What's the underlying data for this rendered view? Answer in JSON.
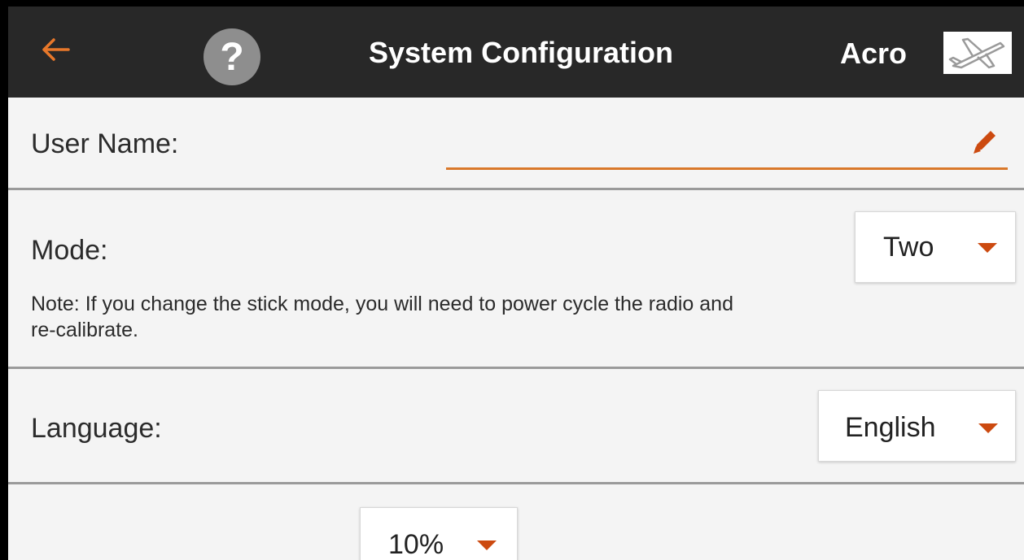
{
  "header": {
    "back_icon": "arrow-left-icon",
    "help_icon": "question-circle-icon",
    "help_symbol": "?",
    "title": "System Configuration",
    "model_name": "Acro",
    "model_type_icon": "airplane-icon",
    "accent_color": "#e8782a",
    "background_color": "#282828"
  },
  "user_name": {
    "label": "User Name:",
    "value": "",
    "edit_icon": "pencil-icon"
  },
  "mode": {
    "label": "Mode:",
    "selected": "Two",
    "note": "Note: If you change the stick mode, you will need to power cycle the radio and\nre-calibrate."
  },
  "language": {
    "label": "Language:",
    "selected": "English"
  },
  "partial_row": {
    "selected": "10%"
  },
  "colors": {
    "field_underline": "#d9782a",
    "dropdown_arrow": "#cc4a10",
    "screen_background": "#f4f4f4"
  }
}
